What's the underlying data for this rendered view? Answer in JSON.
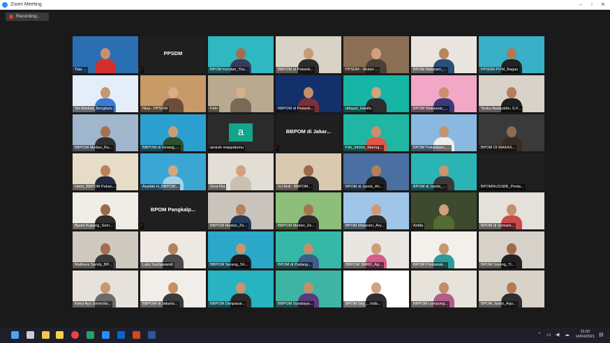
{
  "window": {
    "title": "Zoom Meeting",
    "minimize": "–",
    "maximize": "▫",
    "close": "✕"
  },
  "recording": {
    "label": "Recording..."
  },
  "participants": [
    {
      "name": "Tata ...",
      "kind": "banner",
      "bg": "#2b6fb3",
      "skin": "#c9916b",
      "shirt": "#d32f2f"
    },
    {
      "name": "",
      "kind": "text",
      "center": "PPSDM",
      "bg": "#1f1f1f"
    },
    {
      "name": "BPOM Kendari_Yos...",
      "kind": "person",
      "bg": "#2fb7c2",
      "skin": "#a46d4c",
      "shirt": "#3a3a5a"
    },
    {
      "name": "BBPOM di Pekanb...",
      "kind": "person",
      "bg": "#d9d2c7",
      "skin": "#c99a78",
      "shirt": "#2b2b2b"
    },
    {
      "name": "PPSDM - Wulan ...",
      "kind": "person",
      "bg": "#8a6f55",
      "skin": "#d2a17c",
      "shirt": "#4a4038",
      "active": true
    },
    {
      "name": "BPOM Mataram_...",
      "kind": "person",
      "bg": "#e9e4dd",
      "skin": "#b98462",
      "shirt": "#2a4f7a"
    },
    {
      "name": "PPSDM POM_Bagas",
      "kind": "person",
      "bg": "#3ab0c8",
      "skin": "#ae7a56",
      "shirt": "#222222"
    },
    {
      "name": "SH Marliati_Bengkulu",
      "kind": "person",
      "bg": "#e3eef8",
      "skin": "#c7966f",
      "shirt": "#3a7bd5"
    },
    {
      "name": "Nisa - PPSDM",
      "kind": "person",
      "bg": "#c79a68",
      "skin": "#dcae88",
      "shirt": "#6b4e3a"
    },
    {
      "name": "Febi",
      "kind": "person",
      "bg": "#b9a98f",
      "skin": "#d8b08c",
      "shirt": "#7a6a55"
    },
    {
      "name": "BBPOM di Pekanb...",
      "kind": "person",
      "bg": "#14306b",
      "skin": "#c48e68",
      "shirt": "#7b2f3a"
    },
    {
      "name": "ahlayel_Hanifa",
      "kind": "person",
      "bg": "#17b5a6",
      "skin": "#d3a27e",
      "shirt": "#2d2d2d"
    },
    {
      "name": "BPOM Makassar_...",
      "kind": "person",
      "bg": "#f2a7c7",
      "skin": "#c99169",
      "shirt": "#3a3a7a"
    },
    {
      "name": "Teuku Awaluddin, S.F...",
      "kind": "person",
      "bg": "#d8d2c9",
      "skin": "#b37f5b",
      "shirt": "#1f1f1f"
    },
    {
      "name": "BBPOM Medan_Ra...",
      "kind": "person",
      "bg": "#9fb6cc",
      "skin": "#a77251",
      "shirt": "#2f2f2f"
    },
    {
      "name": "BBPOM di Serang_...",
      "kind": "person",
      "bg": "#2c9fd1",
      "skin": "#cf9c78",
      "shirt": "#2d4f2d"
    },
    {
      "name": "amirah mappatumu",
      "kind": "initial",
      "initial": "a",
      "bg": "#2b2b2b"
    },
    {
      "name": "",
      "kind": "text",
      "center": "BBPOM di Jakar...",
      "bg": "#1f1f1f"
    },
    {
      "name": "Fitri_Inform_Mamuj...",
      "kind": "person",
      "bg": "#1fb7a3",
      "skin": "#c5906b",
      "shirt": "#e0564a"
    },
    {
      "name": "BPOM Pekanbaru_...",
      "kind": "person",
      "bg": "#8bb8e0",
      "skin": "#c49470",
      "shirt": "#eeeeee"
    },
    {
      "name": "BPOM DI MAKAS...",
      "kind": "person",
      "bg": "#3a3a3a",
      "skin": "#8d6a50",
      "shirt": "#3a2b20"
    },
    {
      "name": "Hotel_BBPOM Pekan...",
      "kind": "person",
      "bg": "#e7dcc7",
      "skin": "#b8825c",
      "shirt": "#222b44"
    },
    {
      "name": "Asyifah H_BBPOM...",
      "kind": "person",
      "bg": "#3aa6d4",
      "skin": "#d6a680",
      "shirt": "#a5d1e8"
    },
    {
      "name": "Zera Ria",
      "kind": "person",
      "bg": "#e2ddd5",
      "skin": "#d1a27e",
      "shirt": "#c9c0b0"
    },
    {
      "name": "GJ Ardi - BBPOM...",
      "kind": "person",
      "bg": "#d9c9ae",
      "skin": "#9b6a48",
      "shirt": "#2a2a2a"
    },
    {
      "name": "BPOM di Jambi_Ah...",
      "kind": "person",
      "bg": "#4a6fa0",
      "skin": "#b58059",
      "shirt": "#1e1e1e"
    },
    {
      "name": "BPOM di Jambi_...",
      "kind": "person",
      "bg": "#2ab4b4",
      "skin": "#c8966f",
      "shirt": "#3a3a3a"
    },
    {
      "name": "BPOMNUSSBB_Pinda...",
      "kind": "blank",
      "bg": "#1f1f1f"
    },
    {
      "name": "Bpom Kupang_Sem...",
      "kind": "person",
      "bg": "#f0ece6",
      "skin": "#9b6c4a",
      "shirt": "#2d2d2d"
    },
    {
      "name": "",
      "kind": "text",
      "center": "BPOM Pangkalp...",
      "bg": "#1f1f1f"
    },
    {
      "name": "BBPOM Medan_Ze...",
      "kind": "person",
      "bg": "#c9c3bb",
      "skin": "#b5825e",
      "shirt": "#253a5a"
    },
    {
      "name": "BBPOM Medan_Ze...",
      "kind": "person",
      "bg": "#8dbf7a",
      "skin": "#a8734f",
      "shirt": "#2b2b2b"
    },
    {
      "name": "BPOM Mataram_Ary...",
      "kind": "person",
      "bg": "#9fc5e8",
      "skin": "#cc9a74",
      "shirt": "#2d2d2d"
    },
    {
      "name": "Ardila",
      "kind": "person",
      "bg": "#3d4a2e",
      "skin": "#d0a07b",
      "shirt": "#556b2f"
    },
    {
      "name": "BPOM di Semaro...",
      "kind": "person",
      "bg": "#e4e0da",
      "skin": "#c58f69",
      "shirt": "#c94a4a"
    },
    {
      "name": "Matheos Sandy_BP...",
      "kind": "person",
      "bg": "#cfc9c0",
      "skin": "#a26e4b",
      "shirt": "#3a3a3a"
    },
    {
      "name": "Laily Sanhawandi",
      "kind": "person",
      "bg": "#ede9e2",
      "skin": "#b6825d",
      "shirt": "#4a4a4a"
    },
    {
      "name": "BBPOM Serang_Sh...",
      "kind": "person",
      "bg": "#2aa7c9",
      "skin": "#c9956f",
      "shirt": "#1e1e1e"
    },
    {
      "name": "BPOM di Padang...",
      "kind": "person",
      "bg": "#35b8a8",
      "skin": "#c4906a",
      "shirt": "#3b5e8a"
    },
    {
      "name": "BBPOM SMRD_Ag...",
      "kind": "person",
      "bg": "#e9e6e1",
      "skin": "#caa07a",
      "shirt": "#d65c8a"
    },
    {
      "name": "BPOM Pontianak...",
      "kind": "person",
      "bg": "#f3f0ec",
      "skin": "#c89870",
      "shirt": "#2d9b9b"
    },
    {
      "name": "BPOM Sorong_Ti...",
      "kind": "person",
      "bg": "#d6d1c9",
      "skin": "#9f6a47",
      "shirt": "#222222"
    },
    {
      "name": "Ketut Ayu Sonecita...",
      "kind": "person",
      "bg": "#e6e1da",
      "skin": "#c9976f",
      "shirt": "#6b6b6b"
    },
    {
      "name": "BBPOM di Jakarta...",
      "kind": "person",
      "bg": "#f1eee9",
      "skin": "#c59066",
      "shirt": "#3a3a3a"
    },
    {
      "name": "BBPOM Denpasar...",
      "kind": "person",
      "bg": "#27b3c0",
      "skin": "#c8956f",
      "shirt": "#2a2a2a"
    },
    {
      "name": "BBPOM Surabaya...",
      "kind": "person",
      "bg": "#3fb4a4",
      "skin": "#c38f68",
      "shirt": "#5a3a7a"
    },
    {
      "name": "BPOM Sby_...inda...",
      "kind": "person",
      "bg": "#ffffff",
      "skin": "#d2a27e",
      "shirt": "#2f2f2f"
    },
    {
      "name": "BBPOM Lampung...",
      "kind": "person",
      "bg": "#e7e2da",
      "skin": "#c08c66",
      "shirt": "#b35c8a"
    },
    {
      "name": "BPOM Jambi_Aqu...",
      "kind": "person",
      "bg": "#d8d2c9",
      "skin": "#b07a55",
      "shirt": "#2d2d2d"
    }
  ],
  "taskbar": {
    "time": "15:03",
    "date": "14/04/2021",
    "icons": [
      {
        "name": "windows-start-icon",
        "color": "#4aa3ff"
      },
      {
        "name": "task-view-icon",
        "color": "#cccccc"
      },
      {
        "name": "file-explorer-icon",
        "color": "#f2c744"
      },
      {
        "name": "sticky-notes-icon",
        "color": "#f7d046"
      },
      {
        "name": "chrome-icon",
        "color": "#e8453c"
      },
      {
        "name": "excel-icon",
        "color": "#21a366"
      },
      {
        "name": "zoom-icon",
        "color": "#2d8cff"
      },
      {
        "name": "mail-icon",
        "color": "#0a64c9"
      },
      {
        "name": "powerpoint-icon",
        "color": "#d24726"
      },
      {
        "name": "word-icon",
        "color": "#2b579a"
      }
    ]
  }
}
